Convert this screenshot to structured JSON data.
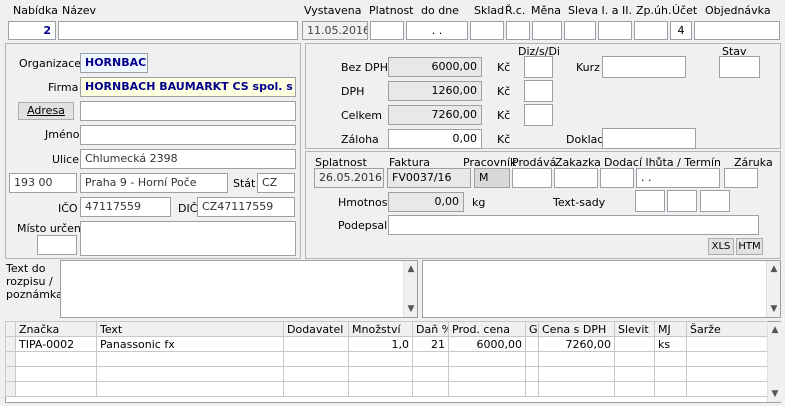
{
  "header": {
    "labels": {
      "nabidka": "Nabídka",
      "nazev": "Název",
      "vystavena": "Vystavena",
      "platnost": "Platnost",
      "do_dne": "do dne",
      "sklad": "Sklad",
      "rc": "Ř.c.",
      "mena": "Měna",
      "sleva": "Sleva I. a II.",
      "zpuh": "Zp.úh.",
      "ucet": "Účet",
      "objednavka": "Objednávka"
    },
    "values": {
      "nabidka": "2",
      "nazev": "",
      "vystavena": "11.05.2016",
      "platnost": "",
      "do_dne": ". .",
      "sklad": "",
      "rc": "",
      "mena": "",
      "sleva1": "",
      "sleva2": "",
      "zpuh": "",
      "ucet": "4",
      "objednavka": ""
    }
  },
  "customer": {
    "labels": {
      "organizace": "Organizace",
      "firma": "Firma",
      "adresa": "Adresa",
      "jmeno": "Jméno",
      "ulice": "Ulice",
      "stat": "Stát",
      "ico": "IČO",
      "dic": "DIČ",
      "misto_urceni": "Místo určení"
    },
    "values": {
      "organizace": "HORNBACH",
      "firma": "HORNBACH BAUMARKT CS spol. s r.o.",
      "adresa": "",
      "jmeno": "",
      "ulice": "Chlumecká 2398",
      "psc": "193 00",
      "mesto": "Praha 9 - Horní Poče",
      "stat": "CZ",
      "ico": "47117559",
      "dic": "CZ47117559",
      "misto1": "",
      "misto2": ""
    }
  },
  "totals": {
    "labels": {
      "bez_dph": "Bez DPH",
      "dph": "DPH",
      "celkem": "Celkem",
      "zaloha": "Záloha",
      "diz": "Diz/s/Di",
      "kurz": "Kurz",
      "stav": "Stav",
      "doklad": "Doklad",
      "kc": "Kč"
    },
    "values": {
      "bez_dph": "6000,00",
      "dph": "1260,00",
      "celkem": "7260,00",
      "zaloha": "0,00",
      "kurz": "",
      "stav": "",
      "doklad": ""
    }
  },
  "invoice": {
    "labels": {
      "splatnost": "Splatnost",
      "faktura": "Faktura",
      "pracovnik": "Pracovník",
      "prodava": "Prodává",
      "zakazka": "Zakazka",
      "dodaci": "Dodací lhůta / Termín",
      "zaruka": "Záruka",
      "hmotnost": "Hmotnost",
      "kg": "kg",
      "text_sady": "Text-sady",
      "podepsal": "Podepsal"
    },
    "values": {
      "splatnost": "26.05.2016",
      "faktura": "FV0037/16",
      "pracovnik": "M",
      "prodava": "",
      "zakazka": "",
      "dodaci": "",
      "termin": ". .",
      "zaruka": "",
      "hmotnost": "0,00",
      "podepsal": ""
    },
    "buttons": {
      "xls": "XLS",
      "htm": "HTM"
    }
  },
  "notes": {
    "label": "Text do rozpisu / poznámka",
    "left": "",
    "right": ""
  },
  "items": {
    "columns": [
      "Značka",
      "Text",
      "Dodavatel",
      "Množství",
      "Daň %",
      "Prod. cena",
      "G",
      "Cena s DPH",
      "Slevit",
      "MJ",
      "Šarže"
    ],
    "rows": [
      [
        "TIPA-0002",
        "Panassonic fx",
        "",
        "1,0",
        "21",
        "6000,00",
        "",
        "7260,00",
        "",
        "ks",
        ""
      ],
      [
        "",
        "",
        "",
        "",
        "",
        "",
        "",
        "",
        "",
        "",
        ""
      ],
      [
        "",
        "",
        "",
        "",
        "",
        "",
        "",
        "",
        "",
        "",
        ""
      ],
      [
        "",
        "",
        "",
        "",
        "",
        "",
        "",
        "",
        "",
        "",
        ""
      ]
    ]
  }
}
